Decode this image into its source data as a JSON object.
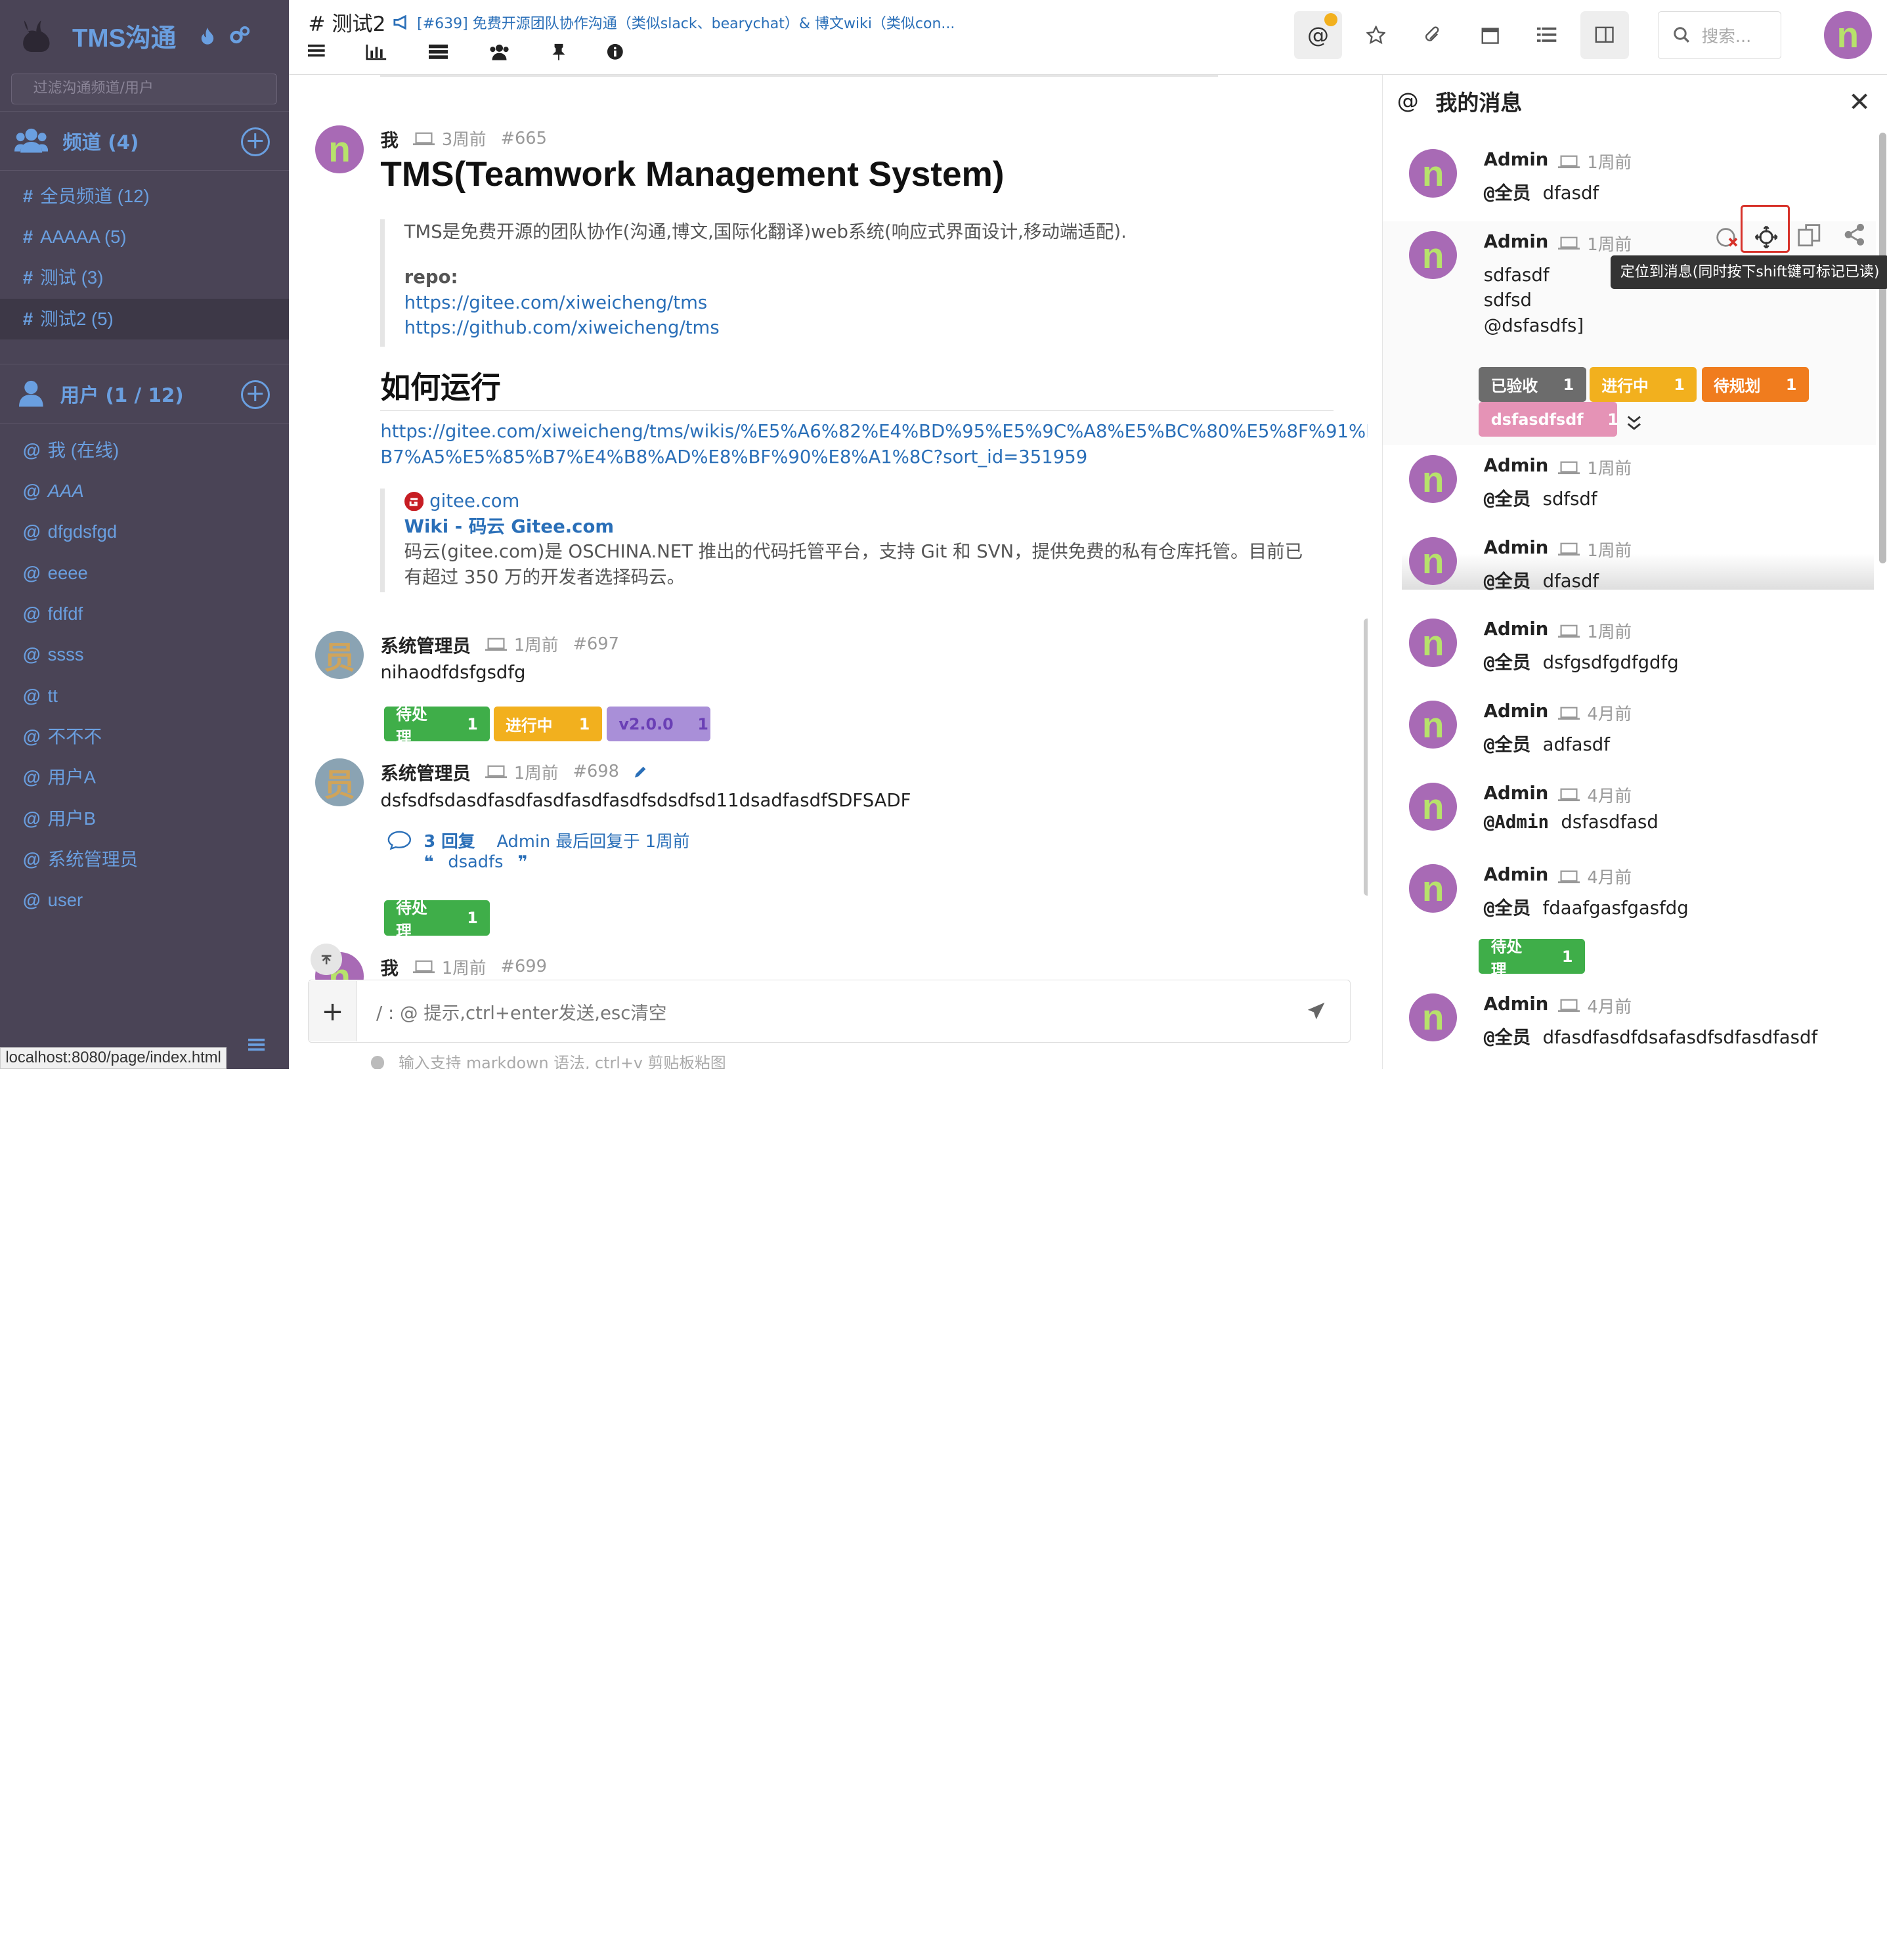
{
  "sidebar": {
    "brand": "TMS沟通",
    "filter_placeholder": "过滤沟通频道/用户",
    "channels_label": "频道 (4)",
    "channels": [
      {
        "name": "全员频道 (12)"
      },
      {
        "name": "AAAAA (5)"
      },
      {
        "name": "测试 (3)"
      },
      {
        "name": "测试2 (5)"
      }
    ],
    "users_label": "用户 (1 / 12)",
    "users": [
      {
        "name": "我 (在线)"
      },
      {
        "name": "AAA"
      },
      {
        "name": "dfgdsfgd"
      },
      {
        "name": "eeee"
      },
      {
        "name": "fdfdf"
      },
      {
        "name": "ssss"
      },
      {
        "name": "tt"
      },
      {
        "name": "不不不"
      },
      {
        "name": "用户A"
      },
      {
        "name": "用户B"
      },
      {
        "name": "系统管理员"
      },
      {
        "name": "user"
      }
    ],
    "status_url": "localhost:8080/page/index.html"
  },
  "topbar": {
    "channel_title": "# 测试2",
    "announcement": "[#639] 免费开源团队协作沟通（类似slack、bearychat）& 博文wiki（类似con...",
    "search_placeholder": "搜索..."
  },
  "messages": {
    "m1": {
      "author": "我",
      "time": "3周前",
      "id": "#665",
      "title": "TMS(Teamwork Management System)",
      "quote": "TMS是免费开源的团队协作(沟通,博文,国际化翻译)web系统(响应式界面设计,移动端适配).",
      "repo_label": "repo:",
      "repo_links": [
        "https://gitee.com/xiweicheng/tms",
        "https://github.com/xiweicheng/tms"
      ],
      "heading2": "如何运行",
      "wiki_link_line1": "https://gitee.com/xiweicheng/tms/wikis/%E5%A6%82%E4%BD%95%E5%9C%A8%E5%BC%80%E5%8F%91%E5%",
      "wiki_link_line2": "B7%A5%E5%85%B7%E4%B8%AD%E8%BF%90%E8%A1%8C?sort_id=351959",
      "card_site": "gitee.com",
      "card_title": "Wiki - 码云 Gitee.com",
      "card_desc_line1": "码云(gitee.com)是 OSCHINA.NET 推出的代码托管平台，支持 Git 和 SVN，提供免费的私有仓库托管。目前已",
      "card_desc_line2": "有超过 350 万的开发者选择码云。"
    },
    "m2": {
      "author": "系统管理员",
      "time": "1周前",
      "id": "#697",
      "text": "nihaodfdsfgsdfg",
      "tags": [
        {
          "label": "待处理",
          "count": "1",
          "color": "#3fae49"
        },
        {
          "label": "进行中",
          "count": "1",
          "color": "#f2b01e"
        },
        {
          "label": "v2.0.0",
          "count": "1",
          "color": "#a98fd8"
        }
      ]
    },
    "m3": {
      "author": "系统管理员",
      "time": "1周前",
      "id": "#698",
      "text": "dsfsdfsdasdfasdfasdfasdfasdfsdsdfsd11dsadfasdfSDFSADF",
      "replies": "3 回复",
      "last_reply": "Admin 最后回复于 1周前",
      "reply_quote": "dsadfs",
      "tags": [
        {
          "label": "待处理",
          "count": "1",
          "color": "#3fae49"
        }
      ]
    },
    "m4": {
      "author": "我",
      "time": "1周前",
      "id": "#699"
    }
  },
  "input": {
    "placeholder": "/ : @ 提示,ctrl+enter发送,esc清空",
    "hint": "输入支持 markdown 语法, ctrl+v 剪贴板粘图"
  },
  "right_panel": {
    "title": "我的消息",
    "tooltip": "定位到消息(同时按下shift键可标记已读)",
    "items": [
      {
        "author": "Admin",
        "time": "1周前",
        "mention": "@全员",
        "text": "dfasdf"
      },
      {
        "author": "Admin",
        "time": "1周前",
        "lines": [
          "sdfasdf",
          "sdfsd",
          "@dsfasdfs]"
        ],
        "tags": [
          {
            "label": "已验收",
            "count": "1",
            "color": "#6c6c6c"
          },
          {
            "label": "进行中",
            "count": "1",
            "color": "#f2b01e"
          },
          {
            "label": "待规划",
            "count": "1",
            "color": "#f07c1e"
          },
          {
            "label": "dsfasdfsdf",
            "count": "1",
            "color": "#e07aa6"
          }
        ]
      },
      {
        "author": "Admin",
        "time": "1周前",
        "mention": "@全员",
        "text": "sdfsdf"
      },
      {
        "author": "Admin",
        "time": "1周前",
        "mention": "@全员",
        "text": "dfasdf"
      },
      {
        "author": "Admin",
        "time": "1周前",
        "mention": "@全员",
        "text": "dsfgsdfgdfgdfg"
      },
      {
        "author": "Admin",
        "time": "4月前",
        "mention": "@全员",
        "text": "adfasdf"
      },
      {
        "author": "Admin",
        "time": "4月前",
        "mention": "@Admin",
        "text": "dsfasdfasd"
      },
      {
        "author": "Admin",
        "time": "4月前",
        "mention": "@全员",
        "text": "fdaafgasfgasfdg",
        "tags": [
          {
            "label": "待处理",
            "count": "1",
            "color": "#3fae49"
          }
        ]
      },
      {
        "author": "Admin",
        "time": "4月前",
        "mention": "@全员",
        "text": "dfasdfasdfdsafasdfsdfasdfasdf"
      }
    ]
  },
  "avatar_letter": "n",
  "sys_avatar_char": "员"
}
